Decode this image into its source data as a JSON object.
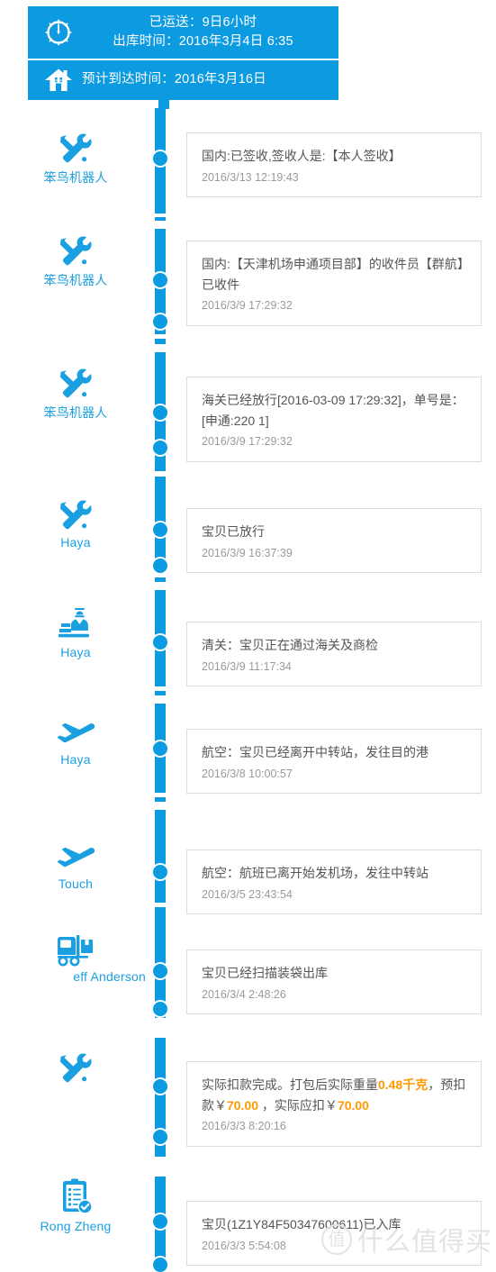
{
  "header": {
    "clock_icon": "clock-icon",
    "home_icon": "home-icon",
    "elapsed_line": "已运送：9日6小时",
    "dispatch_line": "出库时间：2016年3月4日 6:35",
    "eta_line": "预计到达时间：2016年3月16日"
  },
  "theme": {
    "blue": "#0c9ae0",
    "link_blue": "#1a9fe0",
    "orange": "#ff9900",
    "card_border": "#dcdcdc",
    "text": "#555555",
    "muted": "#9a9a9a"
  },
  "timeline": {
    "entries": [
      {
        "icon": "tools-icon",
        "actor": "笨鸟机器人",
        "text": "国内:已签收,签收人是:【本人签收】",
        "time": "2016/3/13 12:19:43"
      },
      {
        "icon": "tools-icon",
        "actor": "笨鸟机器人",
        "text": "国内:【天津机场申通项目部】的收件员【群航】已收件",
        "time": "2016/3/9 17:29:32"
      },
      {
        "icon": "tools-icon",
        "actor": "笨鸟机器人",
        "text": "海关已经放行[2016-03-09 17:29:32]，单号是：[申通:220           1]",
        "time": "2016/3/9 17:29:32"
      },
      {
        "icon": "tools-icon",
        "actor": "Haya",
        "text": "宝贝已放行",
        "time": "2016/3/9 16:37:39"
      },
      {
        "icon": "customs-officer-icon",
        "actor": "Haya",
        "text": "清关：宝贝正在通过海关及商检",
        "time": "2016/3/9 11:17:34"
      },
      {
        "icon": "airplane-icon",
        "actor": "Haya",
        "text": "航空：宝贝已经离开中转站，发往目的港",
        "time": "2016/3/8 10:00:57"
      },
      {
        "icon": "airplane-icon",
        "actor": "Touch",
        "text": "航空：航班已离开始发机场，发往中转站",
        "time": "2016/3/5 23:43:54"
      },
      {
        "icon": "forklift-icon",
        "actor": "eff Anderson",
        "text": "宝贝已经扫描装袋出库",
        "time": "2016/3/4 2:48:26"
      },
      {
        "icon": "tools-icon",
        "actor": "",
        "text_parts": [
          {
            "t": "实际扣款完成。打包后实际重量",
            "hl": false
          },
          {
            "t": "0.48千克",
            "hl": true
          },
          {
            "t": "，预扣款￥",
            "hl": false
          },
          {
            "t": "70.00",
            "hl": true
          },
          {
            "t": " ，实际应扣￥",
            "hl": false
          },
          {
            "t": "70.00",
            "hl": true
          }
        ],
        "time": "2016/3/3 8:20:16"
      },
      {
        "icon": "clipboard-check-icon",
        "actor": "Rong Zheng",
        "text": "宝贝(1Z1Y84F50347600611)已入库",
        "time": "2016/3/3 5:54:08"
      }
    ]
  },
  "watermark": {
    "badge": "值",
    "text": "什么值得买"
  }
}
